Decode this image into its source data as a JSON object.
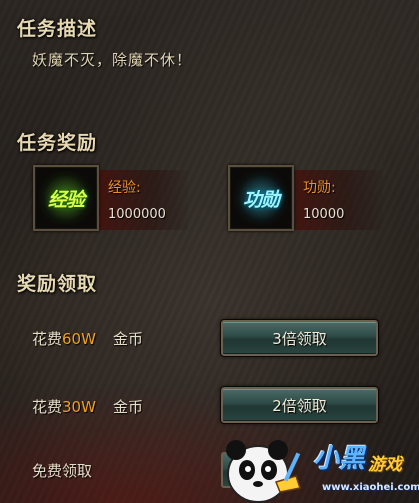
{
  "description": {
    "heading": "任务描述",
    "text": "妖魔不灭，除魔不休！"
  },
  "rewards": {
    "heading": "任务奖励",
    "items": [
      {
        "icon": "exp-icon",
        "icon_text": "经验",
        "label": "经验:",
        "value": "1000000"
      },
      {
        "icon": "merit-icon",
        "icon_text": "功勋",
        "label": "功勋:",
        "value": "10000"
      }
    ]
  },
  "claim": {
    "heading": "奖励领取",
    "rows": [
      {
        "prefix": "花费",
        "cost": "60W",
        "currency": "金币",
        "button": "3倍领取"
      },
      {
        "prefix": "花费",
        "cost": "30W",
        "currency": "金币",
        "button": "2倍领取"
      },
      {
        "label": "免费领取"
      }
    ]
  },
  "colors": {
    "heading": "#e6d8b0",
    "cost": "#f0a020",
    "reward_label": "#e8902c",
    "button": "#2d4a46"
  },
  "watermark": {
    "brand": "小黑",
    "game": "游戏",
    "url": "www.xiaohei.com"
  }
}
